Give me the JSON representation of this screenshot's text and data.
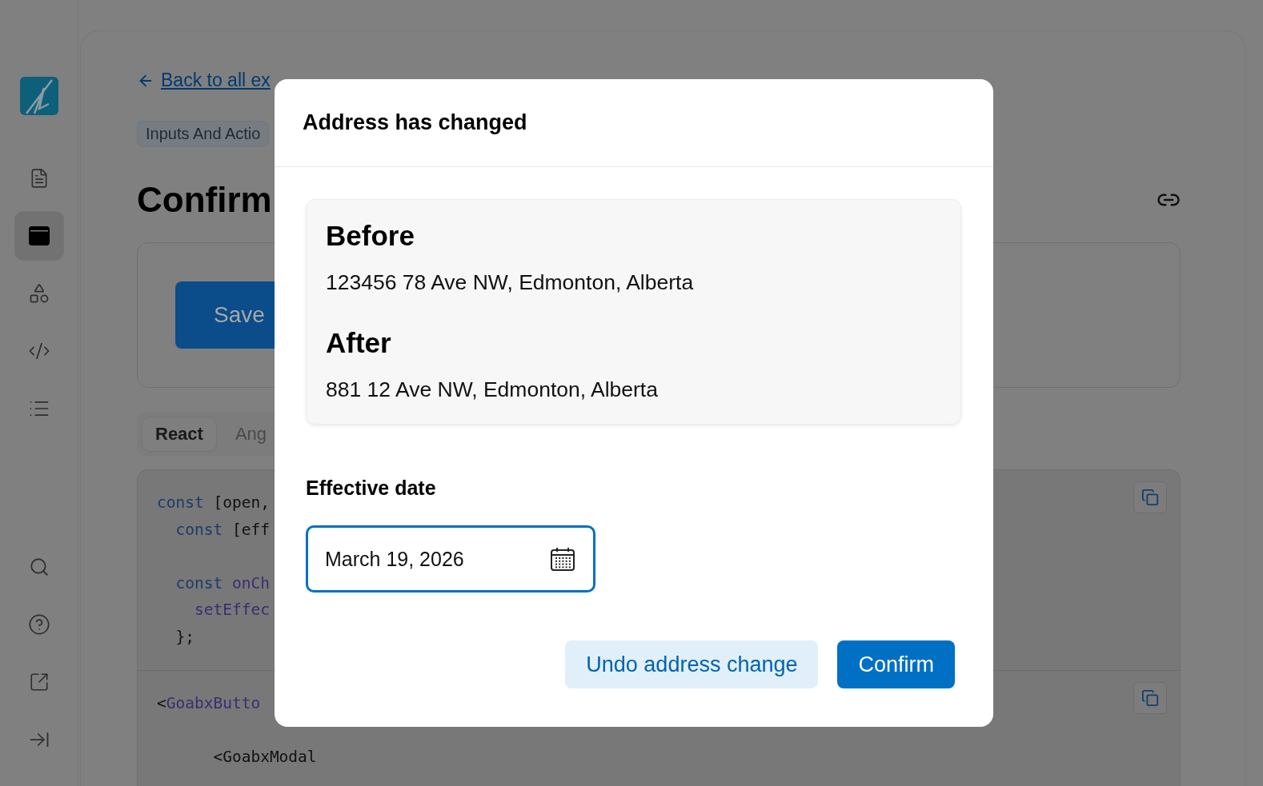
{
  "sidebar": {
    "items": [
      {
        "kind": "document",
        "selected": false
      },
      {
        "kind": "window",
        "selected": true
      },
      {
        "kind": "shapes",
        "selected": false
      },
      {
        "kind": "code",
        "selected": false
      },
      {
        "kind": "list",
        "selected": false
      }
    ],
    "bottom_items": [
      {
        "kind": "search",
        "selected": false
      },
      {
        "kind": "help",
        "selected": false
      },
      {
        "kind": "external",
        "selected": false
      },
      {
        "kind": "collapse",
        "selected": false
      }
    ]
  },
  "page": {
    "back_link": "Back to all ex",
    "tag": "Inputs And Actio",
    "title": "Confirm",
    "example_button": "Save",
    "tabs": [
      {
        "label": "React",
        "selected": true
      },
      {
        "label": "Ang",
        "selected": false
      }
    ],
    "code_sections": [
      {
        "lines": [
          {
            "kind": "code",
            "tokens": [
              {
                "text": "const",
                "kind": "keyword"
              },
              {
                "text": " [open,",
                "kind": "plain"
              }
            ]
          },
          {
            "kind": "code",
            "tokens": [
              {
                "text": "  const",
                "kind": "keyword"
              },
              {
                "text": " [eff",
                "kind": "plain"
              }
            ]
          },
          {
            "kind": "blank"
          },
          {
            "kind": "code",
            "tokens": [
              {
                "text": "  const",
                "kind": "keyword"
              },
              {
                "text": " onCh",
                "kind": "function"
              }
            ]
          },
          {
            "kind": "code",
            "tokens": [
              {
                "text": "    setEffec",
                "kind": "function"
              }
            ]
          },
          {
            "kind": "code",
            "tokens": [
              {
                "text": "  };",
                "kind": "plain"
              }
            ]
          }
        ]
      },
      {
        "lines": [
          {
            "kind": "code",
            "tokens": [
              {
                "text": "<",
                "kind": "plain"
              },
              {
                "text": "GoabxButto",
                "kind": "function"
              }
            ]
          },
          {
            "kind": "blank"
          },
          {
            "kind": "code",
            "tokens": [
              {
                "text": "      <GoabxModal",
                "kind": "plain"
              }
            ]
          }
        ]
      }
    ]
  },
  "modal": {
    "heading": "Address has changed",
    "summary": [
      {
        "title": "Before",
        "address": "123456 78 Ave NW, Edmonton, Alberta"
      },
      {
        "title": "After",
        "address": "881 12 Ave NW, Edmonton, Alberta"
      }
    ],
    "date_field": {
      "label": "Effective date",
      "value": "March 19, 2026"
    },
    "buttons": [
      {
        "label": "Undo address change",
        "kind": "secondary"
      },
      {
        "label": "Confirm",
        "kind": "primary"
      }
    ]
  }
}
